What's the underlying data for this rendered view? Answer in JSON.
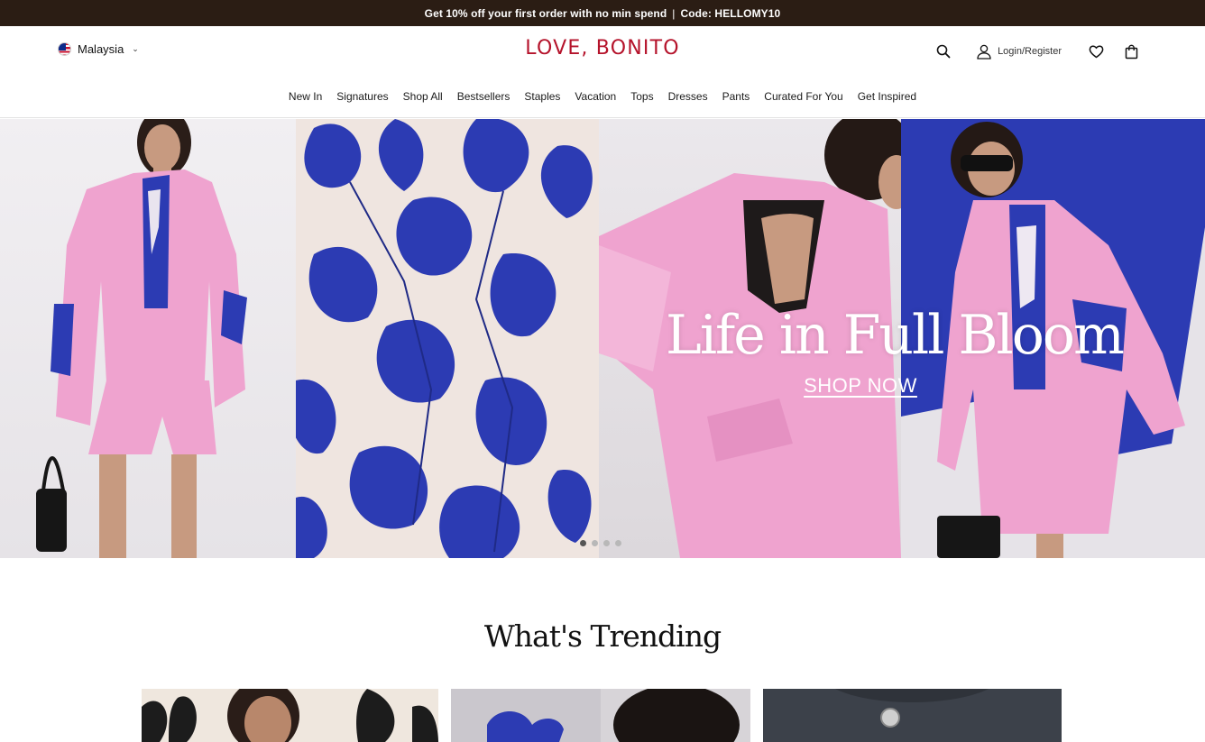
{
  "promo": {
    "text_prefix": "Get 10% off your first order with no min spend",
    "separator": "|",
    "code_label": "Code:",
    "code": "HELLOMY10"
  },
  "header": {
    "region": "Malaysia",
    "brand": "LOVE, BONITO",
    "login_label": "Login/Register",
    "icons": [
      "search-icon",
      "user-icon",
      "heart-icon",
      "bag-icon"
    ]
  },
  "nav": {
    "items": [
      "New In",
      "Signatures",
      "Shop All",
      "Bestsellers",
      "Staples",
      "Vacation",
      "Tops",
      "Dresses",
      "Pants",
      "Curated For You",
      "Get Inspired"
    ]
  },
  "hero": {
    "title": "Life in Full Bloom",
    "cta": "SHOP NOW",
    "slide_count": 4,
    "active_slide": 1
  },
  "trending": {
    "title": "What's Trending"
  },
  "colors": {
    "promo_bg": "#2b1d14",
    "brand_red": "#b5132b",
    "print_blue": "#2c3bb3",
    "blazer_pink": "#efa3cf"
  }
}
